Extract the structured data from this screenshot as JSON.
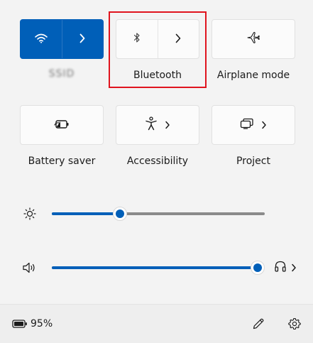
{
  "tiles_row1": {
    "wifi": {
      "label": "SSID",
      "state": "active"
    },
    "bluetooth": {
      "label": "Bluetooth"
    },
    "airplane": {
      "label": "Airplane mode"
    }
  },
  "tiles_row2": {
    "battery_saver": {
      "label": "Battery saver"
    },
    "accessibility": {
      "label": "Accessibility"
    },
    "project": {
      "label": "Project"
    }
  },
  "sliders": {
    "brightness": {
      "value": 0.32
    },
    "volume": {
      "value": 1.0
    }
  },
  "footer": {
    "battery_percent": "95%"
  },
  "colors": {
    "accent": "#005fb8",
    "highlight": "#e0141e"
  },
  "icons": {
    "wifi": "wifi-icon",
    "bluetooth": "bluetooth-icon",
    "airplane": "airplane-icon",
    "battery_saver": "battery-saver-icon",
    "accessibility": "accessibility-icon",
    "project": "project-icon",
    "brightness": "sun-icon",
    "volume": "speaker-icon",
    "audio_output": "headphones-icon",
    "battery": "battery-icon",
    "edit": "pencil-icon",
    "settings": "gear-icon"
  }
}
